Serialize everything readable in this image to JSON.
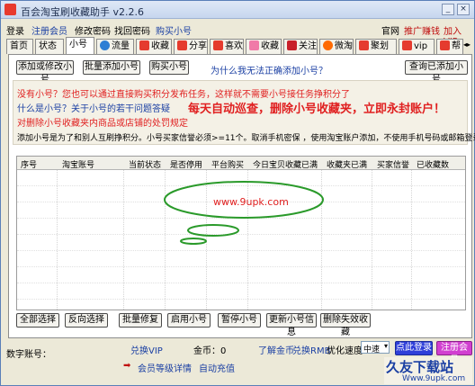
{
  "window": {
    "title": "百会淘宝刷收藏助手 v2.2.6",
    "controls": {
      "minimize": "_",
      "close": "×"
    }
  },
  "menu": {
    "left": [
      "登录",
      "注册会员",
      "修改密码",
      "找回密码",
      "购买小号"
    ],
    "right": [
      "官网",
      "推广赚钱",
      "加入VIP"
    ]
  },
  "tabs": [
    {
      "label": "首页",
      "icon": ""
    },
    {
      "label": "状态",
      "icon": ""
    },
    {
      "label": "小号",
      "icon": ""
    },
    {
      "label": "流量",
      "icon": "globe-icon"
    },
    {
      "label": "收藏",
      "icon": "favorite-icon"
    },
    {
      "label": "分享",
      "icon": "share-icon"
    },
    {
      "label": "喜欢",
      "icon": "like-icon"
    },
    {
      "label": "收藏",
      "icon": "heart-icon"
    },
    {
      "label": "关注",
      "icon": "follow-icon"
    },
    {
      "label": "微淘",
      "icon": "weitao-icon"
    },
    {
      "label": "聚划算",
      "icon": "juhuasuan-icon"
    },
    {
      "label": "vip站",
      "icon": "vip-icon"
    },
    {
      "label": "帮",
      "icon": "help-icon"
    }
  ],
  "toolbar": {
    "add_modify": "添加或修改小号",
    "batch_add": "批量添加小号",
    "buy": "购买小号",
    "question": "为什么我无法正确添加小号？",
    "query_added": "查询已添加小号"
  },
  "info": {
    "line1": "没有小号？您也可以通过直接购买积分发布任务，这样就不需要小号接任务挣积分了",
    "line2": "什么是小号？关于小号的若干问题答疑",
    "line3": "对删除小号收藏夹内商品或店铺的处罚规定",
    "big_notice": "每天自动巡查，删除小号收藏夹，立即永封账户！",
    "line4": "添加小号是为了和别人互刷挣积分。小号买家信誉必须>=11个。取消手机密保 ，使用淘宝账户添加，不使用手机号码或邮箱登录名。"
  },
  "table": {
    "columns": [
      "序号",
      "淘宝账号",
      "当前状态",
      "是否停用",
      "平台购买",
      "今日宝贝收藏已满",
      "收藏夹已满",
      "买家信誉",
      "已收藏数"
    ],
    "rows": [],
    "watermark": "www.9upk.com"
  },
  "bottom_buttons": [
    "全部选择",
    "反向选择",
    "批量修复",
    "启用小号",
    "暂停小号",
    "更新小号信息",
    "删除失效收藏"
  ],
  "status": {
    "digital_account_label": "数字账号：",
    "vip_exchange": "兑换VIP",
    "coins_label": "金币：0",
    "about_coins": "了解金币",
    "rmb_exchange": "兑换RMB",
    "speed_label": "优化速度",
    "speed_value": "中速",
    "login_button": "点此登录",
    "register_button": "注册会员",
    "member_level": "会员等级详情",
    "auto_recharge": "自动充值",
    "site_banner": "久友下载站",
    "site_url": "Www.9upk.com"
  },
  "colors": {
    "accent_red": "#e53b2e",
    "notice_red": "#e02020",
    "link_blue": "#1a3fa3",
    "login_blue": "#2f3fd9",
    "register_pink": "#d13fd0"
  }
}
